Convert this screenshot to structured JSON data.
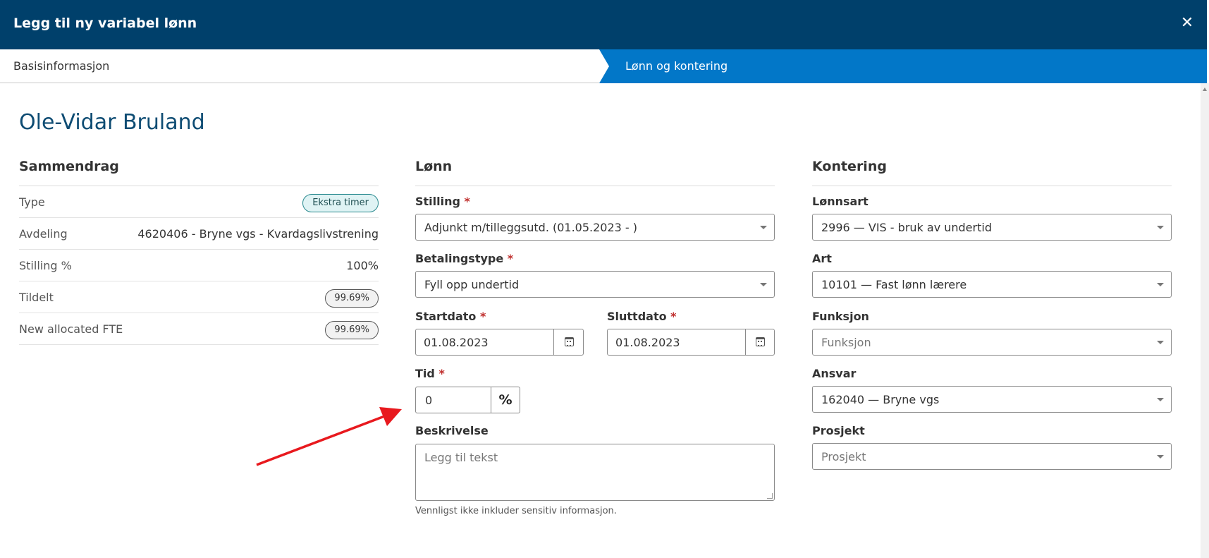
{
  "dialog": {
    "title": "Legg til ny variabel lønn",
    "close_label": "✕"
  },
  "steps": [
    {
      "label": "Basisinformasjon"
    },
    {
      "label": "Lønn og kontering"
    }
  ],
  "employee": {
    "name": "Ole-Vidar Bruland"
  },
  "summary": {
    "title": "Sammendrag",
    "rows": [
      {
        "label": "Type",
        "value": "Ekstra timer"
      },
      {
        "label": "Avdeling",
        "value": "4620406 - Bryne vgs - Kvardagslivstrening"
      },
      {
        "label": "Stilling %",
        "value": "100%"
      },
      {
        "label": "Tildelt",
        "value": "99.69%"
      },
      {
        "label": "New allocated FTE",
        "value": "99.69%"
      }
    ]
  },
  "lonn": {
    "title": "Lønn",
    "stilling": {
      "label": "Stilling",
      "required": "*",
      "value": "Adjunkt m/tilleggsutd. (01.05.2023 - )"
    },
    "betalingstype": {
      "label": "Betalingstype",
      "required": "*",
      "value": "Fyll opp undertid"
    },
    "startdato": {
      "label": "Startdato",
      "required": "*",
      "value": "01.08.2023"
    },
    "sluttdato": {
      "label": "Sluttdato",
      "required": "*",
      "value": "01.08.2023"
    },
    "tid": {
      "label": "Tid",
      "required": "*",
      "value": "0",
      "unit": "%"
    },
    "beskrivelse": {
      "label": "Beskrivelse",
      "placeholder": "Legg til tekst",
      "hint": "Vennligst ikke inkluder sensitiv informasjon."
    }
  },
  "kontering": {
    "title": "Kontering",
    "lonnsart": {
      "label": "Lønnsart",
      "value": "2996 — VIS - bruk av undertid"
    },
    "art": {
      "label": "Art",
      "value": "10101 — Fast lønn lærere"
    },
    "funksjon": {
      "label": "Funksjon",
      "placeholder": "Funksjon"
    },
    "ansvar": {
      "label": "Ansvar",
      "value": "162040 — Bryne vgs"
    },
    "prosjekt": {
      "label": "Prosjekt",
      "placeholder": "Prosjekt"
    }
  },
  "colors": {
    "header_bg": "#00406b",
    "active_step_bg": "#0277c8",
    "name_color": "#0e4c73",
    "annotation_arrow": "#e8191e"
  },
  "icons": [
    "close-icon",
    "calendar-icon",
    "percent-icon",
    "chevron-down-icon"
  ]
}
